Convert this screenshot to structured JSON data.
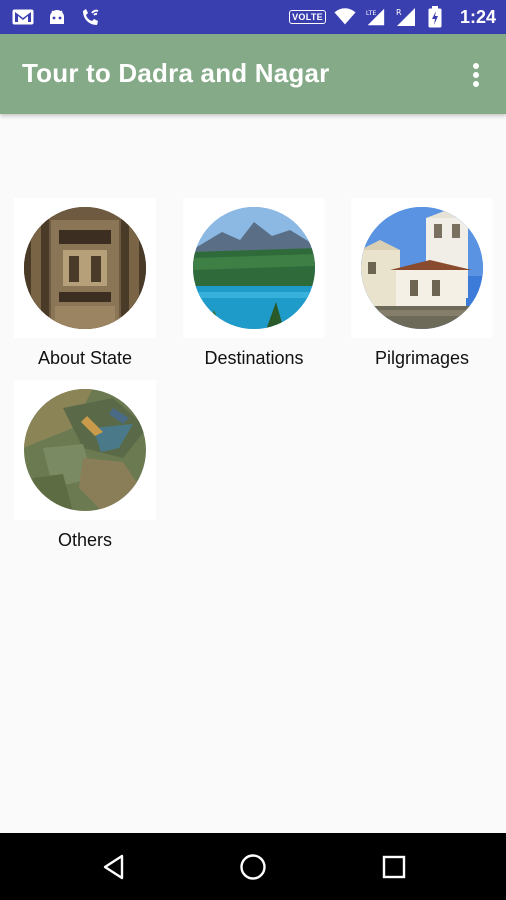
{
  "status_bar": {
    "volte": "VOLTE",
    "time": "1:24",
    "icons": [
      "gmail-icon",
      "android-debug-icon",
      "wifi-calling-icon",
      "volte-badge",
      "wifi-icon",
      "signal-icon",
      "signal-icon",
      "battery-icon"
    ]
  },
  "app_bar": {
    "title": "Tour to Dadra and Nagar",
    "overflow_icon": "more-vert-icon"
  },
  "tiles": [
    {
      "label": "About State",
      "image": "temple-carving"
    },
    {
      "label": "Destinations",
      "image": "lake-mountain"
    },
    {
      "label": "Pilgrimages",
      "image": "church"
    },
    {
      "label": "Others",
      "image": "aerial-map"
    }
  ],
  "nav_bar": {
    "icons": [
      "back-icon",
      "home-icon",
      "recents-icon"
    ]
  },
  "colors": {
    "status_bar": "#3a3fb0",
    "app_bar": "#85aa87",
    "background": "#fafafa",
    "nav_bar": "#000000"
  }
}
